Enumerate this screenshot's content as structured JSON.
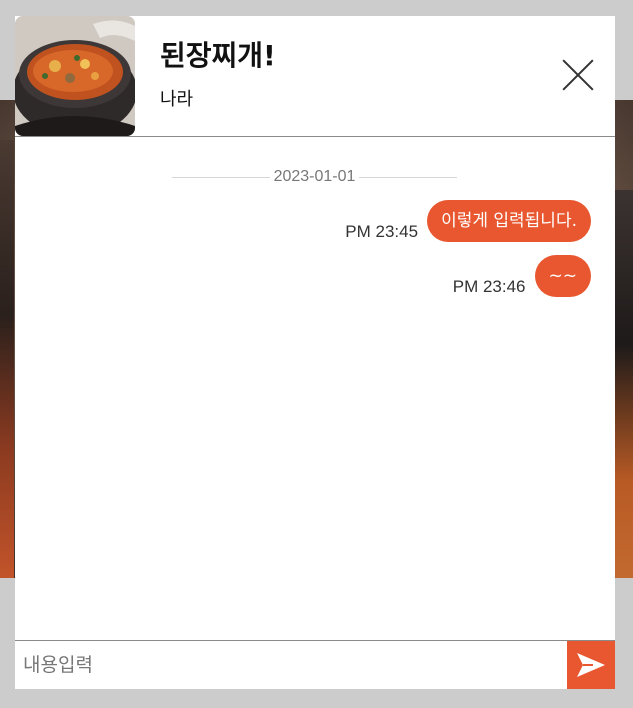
{
  "header": {
    "title": "된장찌개!",
    "subtitle": "나라"
  },
  "chat": {
    "date": "2023-01-01",
    "messages": [
      {
        "time": "PM 23:45",
        "text": "이렇게 입력됩니다."
      },
      {
        "time": "PM 23:46",
        "text": "~~"
      }
    ]
  },
  "input": {
    "placeholder": "내용입력",
    "value": ""
  },
  "colors": {
    "accent": "#e8572f",
    "divider": "#8a8a8a",
    "overlay": "#cccccc"
  },
  "icons": {
    "close": "close-icon",
    "send": "send-icon"
  }
}
